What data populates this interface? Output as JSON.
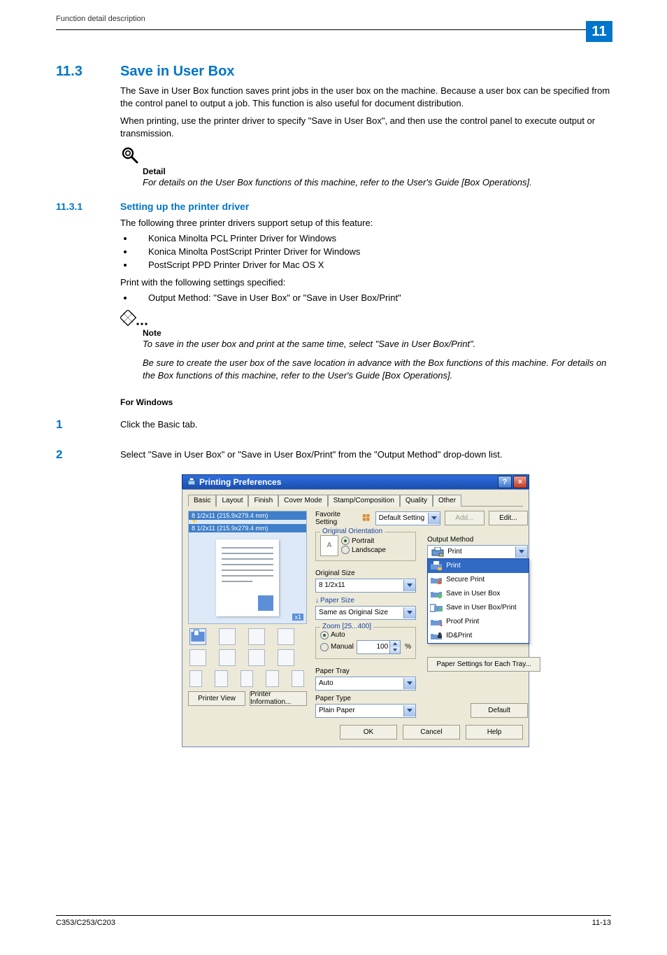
{
  "header": {
    "running": "Function detail description",
    "chapter": "11"
  },
  "section": {
    "number": "11.3",
    "title": "Save in User Box",
    "p1": "The Save in User Box function saves print jobs in the user box on the machine. Because a user box can be specified from the control panel to output a job. This function is also useful for document distribution.",
    "p2": "When printing, use the printer driver to specify \"Save in User Box\", and then use the control panel to execute output or transmission."
  },
  "detail": {
    "title": "Detail",
    "body": "For details on the User Box functions of this machine, refer to the User's Guide [Box Operations]."
  },
  "subsection": {
    "number": "11.3.1",
    "title": "Setting up the printer driver",
    "intro": "The following three printer drivers support setup of this feature:",
    "bullets": [
      "Konica Minolta PCL Printer Driver for Windows",
      "Konica Minolta PostScript Printer Driver for Windows",
      "PostScript PPD Printer Driver for Mac OS X"
    ],
    "print_with": "Print with the following settings specified:",
    "bullets2": [
      "Output Method: \"Save in User Box\" or \"Save in User Box/Print\""
    ]
  },
  "note": {
    "title": "Note",
    "p1": "To save in the user box and print at the same time, select \"Save in User Box/Print\".",
    "p2": "Be sure to create the user box of the save location in advance with the Box functions of this machine. For details on the Box functions of this machine, refer to the User's Guide [Box Operations]."
  },
  "for_windows": {
    "heading": "For Windows",
    "steps": [
      {
        "n": "1",
        "text": "Click the Basic tab."
      },
      {
        "n": "2",
        "text": "Select \"Save in User Box\" or \"Save in User Box/Print\" from the \"Output Method\" drop-down list."
      }
    ]
  },
  "dialog": {
    "title": "Printing Preferences",
    "tabs": [
      "Basic",
      "Layout",
      "Finish",
      "Cover Mode",
      "Stamp/Composition",
      "Quality",
      "Other"
    ],
    "active_tab": 0,
    "favorite": {
      "label": "Favorite Setting",
      "value": "Default Setting",
      "add": "Add...",
      "edit": "Edit..."
    },
    "preview": {
      "size1": "8 1/2x11 (215.9x279.4 mm)",
      "size2": "8 1/2x11 (215.9x279.4 mm)",
      "corner": "x1",
      "printer_view": "Printer View",
      "printer_info": "Printer Information..."
    },
    "orientation": {
      "legend": "Original Orientation",
      "portrait": "Portrait",
      "landscape": "Landscape"
    },
    "original_size": {
      "label": "Original Size",
      "value": "8 1/2x11"
    },
    "paper_size": {
      "label": "Paper Size",
      "value": "Same as Original Size"
    },
    "zoom": {
      "legend": "Zoom [25...400]",
      "auto": "Auto",
      "manual": "Manual",
      "value": "100",
      "percent": "%"
    },
    "paper_tray": {
      "label": "Paper Tray",
      "value": "Auto"
    },
    "paper_type": {
      "label": "Paper Type",
      "value": "Plain Paper"
    },
    "output_method": {
      "label": "Output Method",
      "value": "Print",
      "options": [
        "Print",
        "Secure Print",
        "Save in User Box",
        "Save in User Box/Print",
        "Proof Print",
        "ID&Print"
      ]
    },
    "paper_settings_btn": "Paper Settings for Each Tray...",
    "default_btn": "Default",
    "ok": "OK",
    "cancel": "Cancel",
    "help": "Help"
  },
  "footer": {
    "model": "C353/C253/C203",
    "page": "11-13"
  }
}
